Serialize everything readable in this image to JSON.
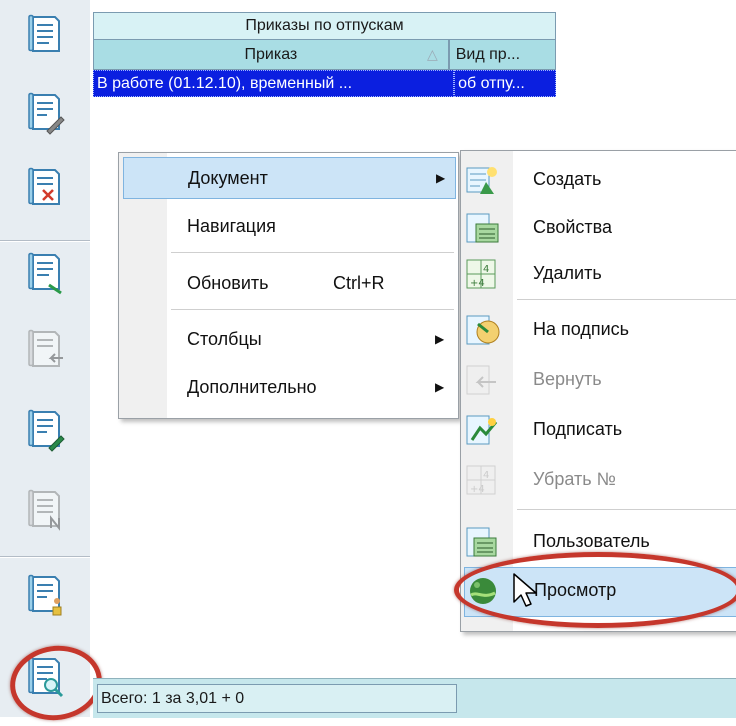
{
  "toolbar": {
    "buttons": [
      {
        "icon": "document-icon",
        "enabled": true
      },
      {
        "icon": "document-edit-icon",
        "enabled": true
      },
      {
        "icon": "document-delete-icon",
        "enabled": true
      },
      {
        "icon": "document-signature-icon",
        "enabled": true
      },
      {
        "icon": "document-return-icon",
        "enabled": false
      },
      {
        "icon": "document-sign-icon",
        "enabled": true
      },
      {
        "icon": "document-number-icon",
        "enabled": false
      },
      {
        "icon": "document-user-icon",
        "enabled": true
      },
      {
        "icon": "document-view-icon",
        "enabled": true,
        "highlighted": true
      }
    ]
  },
  "grid": {
    "title": "Приказы по отпускам",
    "columns": [
      {
        "label": "Приказ",
        "sort_icon": "sort-ascending-icon",
        "sort_glyph": "△"
      },
      {
        "label": "Вид пр..."
      }
    ],
    "rows": [
      {
        "order": "В работе (01.12.10), временный ...",
        "type": "об отпу..."
      }
    ]
  },
  "context_menu": {
    "items": [
      {
        "label": "Документ",
        "has_submenu": true,
        "active": true
      },
      {
        "label": "Навигация"
      },
      {
        "label": "Обновить",
        "shortcut": "Ctrl+R"
      },
      {
        "label": "Столбцы",
        "has_submenu": true
      },
      {
        "label": "Дополнительно",
        "has_submenu": true
      }
    ],
    "submenu_arrow": "▶"
  },
  "submenu": {
    "items": [
      {
        "label": "Создать",
        "icon": "create-icon",
        "enabled": true
      },
      {
        "label": "Свойства",
        "icon": "properties-icon",
        "enabled": true
      },
      {
        "label": "Удалить",
        "icon": "delete-icon",
        "enabled": true
      },
      {
        "label": "На подпись",
        "icon": "send-to-sign-icon",
        "enabled": true
      },
      {
        "label": "Вернуть",
        "icon": "return-icon",
        "enabled": false
      },
      {
        "label": "Подписать",
        "icon": "sign-icon",
        "enabled": true
      },
      {
        "label": "Убрать №",
        "icon": "remove-number-icon",
        "enabled": false
      },
      {
        "label": "Пользователь",
        "icon": "user-icon",
        "enabled": true
      },
      {
        "label": "Просмотр",
        "icon": "preview-icon",
        "enabled": true,
        "active": true
      }
    ]
  },
  "footer": {
    "status": "Всего: 1 за 3,01 + 0"
  },
  "colors": {
    "accent_ring": "#c5372c",
    "selection": "#0b1fe0",
    "menu_highlight": "#cce4f7",
    "grid_header": "#a9dde4",
    "toolbar_bg": "#e7edf2"
  }
}
